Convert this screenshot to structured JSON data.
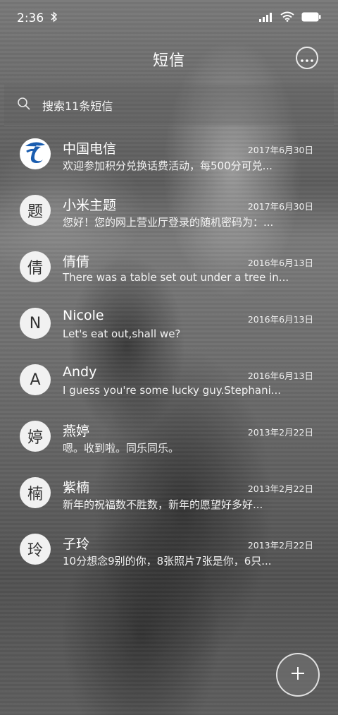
{
  "status_bar": {
    "time": "2:36"
  },
  "header": {
    "title": "短信"
  },
  "search": {
    "placeholder": "搜索11条短信"
  },
  "messages": [
    {
      "name": "中国电信",
      "date": "2017年6月30日",
      "preview": "欢迎参加积分兑换话费活动，每500分可兑...",
      "avatar": "",
      "avatar_icon": "china-telecom-logo"
    },
    {
      "name": "小米主题",
      "date": "2017年6月30日",
      "preview": "您好！您的网上营业厅登录的随机密码为：...",
      "avatar": "题"
    },
    {
      "name": "倩倩",
      "date": "2016年6月13日",
      "preview": "There was a table set out under a tree in...",
      "avatar": "倩"
    },
    {
      "name": "Nicole",
      "date": "2016年6月13日",
      "preview": "Let's eat out,shall we?",
      "avatar": "N"
    },
    {
      "name": "Andy",
      "date": "2016年6月13日",
      "preview": "I guess you're some lucky guy.Stephani...",
      "avatar": "A"
    },
    {
      "name": "燕婷",
      "date": "2013年2月22日",
      "preview": "嗯。收到啦。同乐同乐。",
      "avatar": "婷"
    },
    {
      "name": "紫楠",
      "date": "2013年2月22日",
      "preview": "新年的祝福数不胜数，新年的愿望好多好...",
      "avatar": "楠"
    },
    {
      "name": "子玲",
      "date": "2013年2月22日",
      "preview": "10分想念9别的你，8张照片7张是你，6只...",
      "avatar": "玲"
    }
  ],
  "icons": {
    "bluetooth": "bluetooth-icon",
    "signal": "signal-icon",
    "wifi": "wifi-icon",
    "battery": "battery-icon",
    "more": "more-icon",
    "search": "search-icon",
    "compose": "plus-icon"
  },
  "colors": {
    "telecom_blue": "#1a5db0",
    "avatar_bg": "#f1f1f1"
  }
}
